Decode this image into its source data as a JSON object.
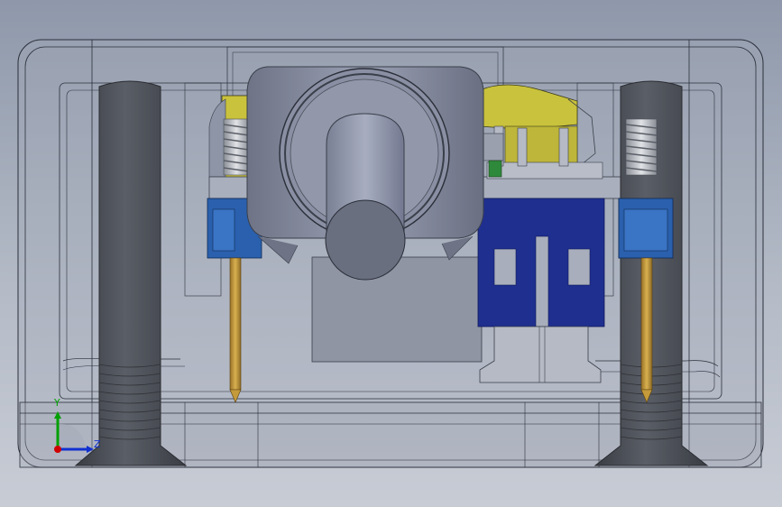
{
  "view": {
    "orientation_triad": {
      "y_label": "Y",
      "z_label": "Z",
      "x_color": "#d00000",
      "y_color": "#00a000",
      "z_color": "#1030d0"
    },
    "colors": {
      "background_top": "#8e98aa",
      "background_bottom": "#c8ccd5",
      "housing": "#9aa1ae",
      "screw": "#4a4d54",
      "knob": "#7e8397",
      "yellow_part": "#c8c040",
      "blue_part": "#2a5fa8",
      "navy_part": "#1f2f8f",
      "pin": "#c49a3a"
    }
  }
}
